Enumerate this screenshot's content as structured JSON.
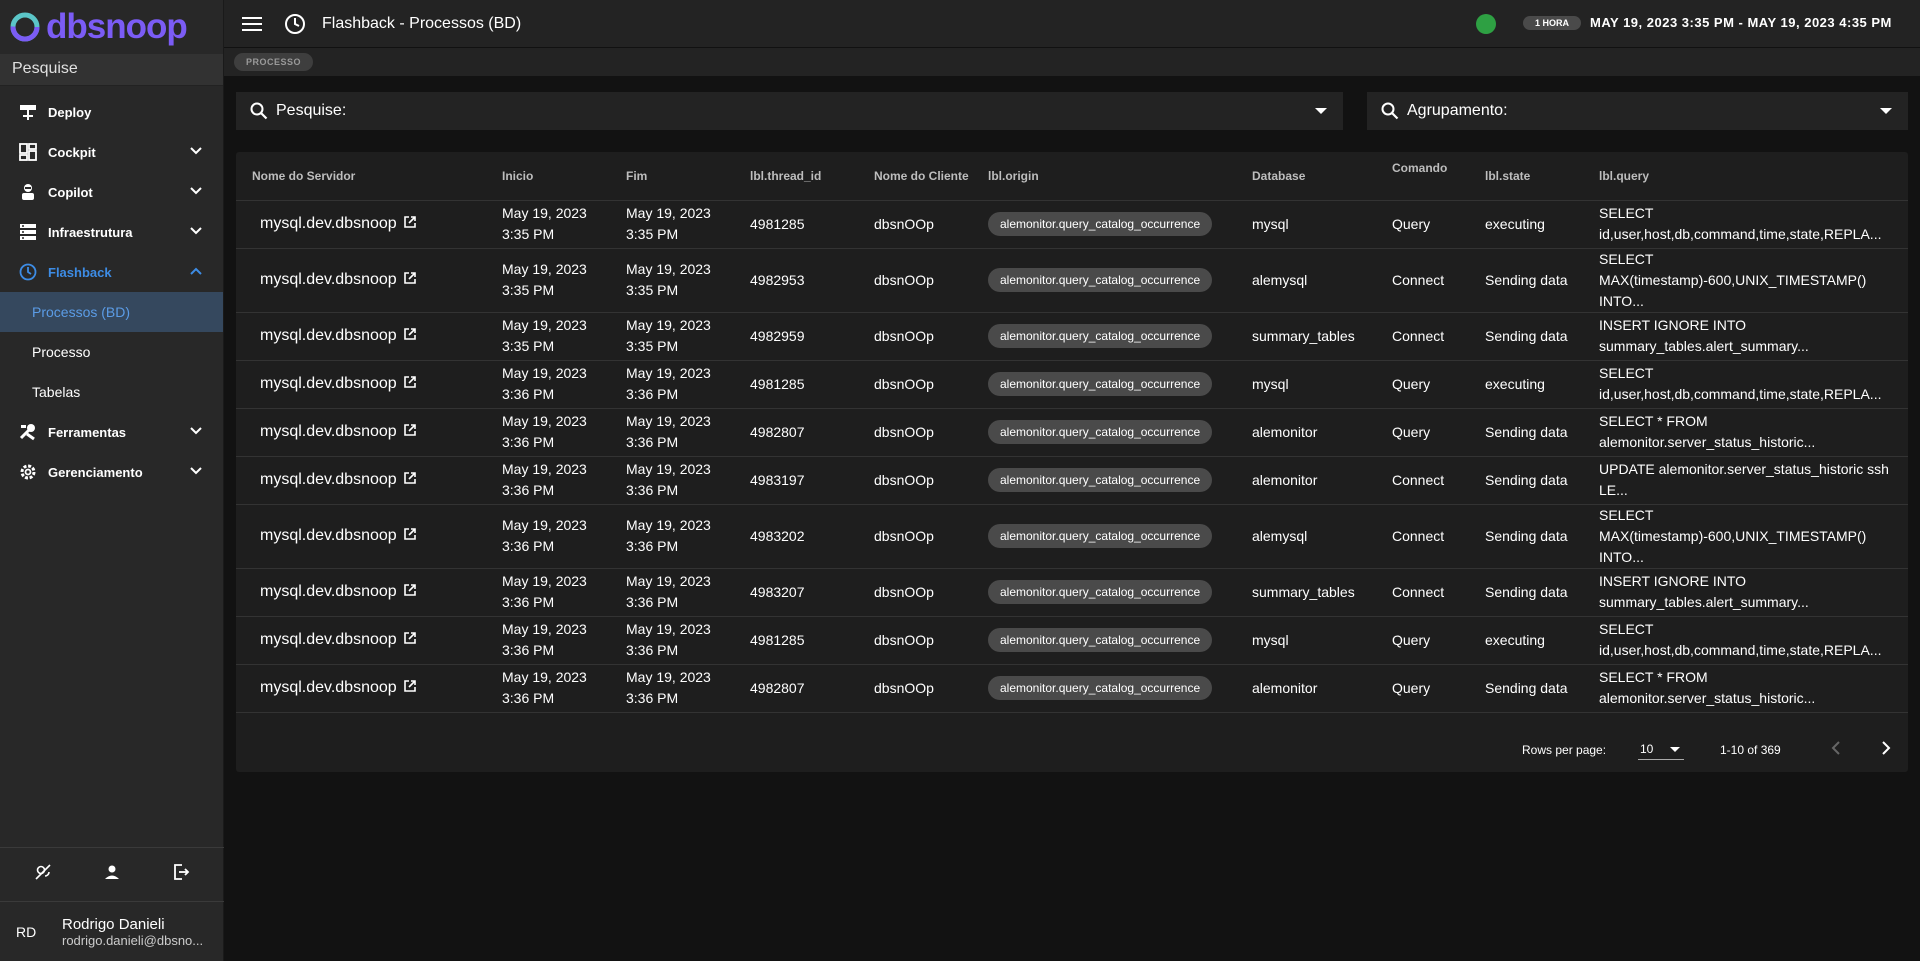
{
  "app": {
    "logo_text": "dbsnoop"
  },
  "sidebar": {
    "search_label": "Pesquise",
    "items": [
      {
        "label": "Deploy",
        "icon": "deploy-icon"
      },
      {
        "label": "Cockpit",
        "icon": "dashboard-icon"
      },
      {
        "label": "Copilot",
        "icon": "robot-icon"
      },
      {
        "label": "Infraestrutura",
        "icon": "server-icon"
      },
      {
        "label": "Flashback",
        "icon": "clock-icon"
      },
      {
        "label": "Ferramentas",
        "icon": "tools-icon"
      },
      {
        "label": "Gerenciamento",
        "icon": "gear-icon"
      }
    ],
    "sub_items": [
      "Processos (BD)",
      "Processo",
      "Tabelas"
    ],
    "user": {
      "initials": "RD",
      "name": "Rodrigo Danieli",
      "email": "rodrigo.danieli@dbsno..."
    }
  },
  "header": {
    "title": "Flashback - Processos (BD)",
    "range_chip": "1 HORA",
    "range_text": "MAY 19, 2023 3:35 PM - MAY 19, 2023 4:35 PM",
    "status_color": "#2ea043"
  },
  "breadcrumb": {
    "chip": "PROCESSO"
  },
  "filters": {
    "search_label": "Pesquise:",
    "group_label": "Agrupamento:"
  },
  "table": {
    "columns": [
      "Nome do Servidor",
      "Inicio",
      "Fim",
      "lbl.thread_id",
      "Nome do Cliente",
      "lbl.origin",
      "Database",
      "Comando",
      "lbl.state",
      "lbl.query"
    ],
    "rows": [
      {
        "server": "mysql.dev.dbsnoop",
        "start_date": "May 19, 2023",
        "start_time": "3:35 PM",
        "end_date": "May 19, 2023",
        "end_time": "3:35 PM",
        "thread": "4981285",
        "client": "dbsnOOp",
        "origin": "alemonitor.query_catalog_occurrence",
        "database": "mysql",
        "command": "Query",
        "state": "executing",
        "query": "SELECT id,user,host,db,command,time,state,REPLA..."
      },
      {
        "server": "mysql.dev.dbsnoop",
        "start_date": "May 19, 2023",
        "start_time": "3:35 PM",
        "end_date": "May 19, 2023",
        "end_time": "3:35 PM",
        "thread": "4982953",
        "client": "dbsnOOp",
        "origin": "alemonitor.query_catalog_occurrence",
        "database": "alemysql",
        "command": "Connect",
        "state": "Sending data",
        "query": "SELECT MAX(timestamp)-600,UNIX_TIMESTAMP() INTO..."
      },
      {
        "server": "mysql.dev.dbsnoop",
        "start_date": "May 19, 2023",
        "start_time": "3:35 PM",
        "end_date": "May 19, 2023",
        "end_time": "3:35 PM",
        "thread": "4982959",
        "client": "dbsnOOp",
        "origin": "alemonitor.query_catalog_occurrence",
        "database": "summary_tables",
        "command": "Connect",
        "state": "Sending data",
        "query": "INSERT IGNORE INTO summary_tables.alert_summary..."
      },
      {
        "server": "mysql.dev.dbsnoop",
        "start_date": "May 19, 2023",
        "start_time": "3:36 PM",
        "end_date": "May 19, 2023",
        "end_time": "3:36 PM",
        "thread": "4981285",
        "client": "dbsnOOp",
        "origin": "alemonitor.query_catalog_occurrence",
        "database": "mysql",
        "command": "Query",
        "state": "executing",
        "query": "SELECT id,user,host,db,command,time,state,REPLA..."
      },
      {
        "server": "mysql.dev.dbsnoop",
        "start_date": "May 19, 2023",
        "start_time": "3:36 PM",
        "end_date": "May 19, 2023",
        "end_time": "3:36 PM",
        "thread": "4982807",
        "client": "dbsnOOp",
        "origin": "alemonitor.query_catalog_occurrence",
        "database": "alemonitor",
        "command": "Query",
        "state": "Sending data",
        "query": "SELECT * FROM alemonitor.server_status_historic..."
      },
      {
        "server": "mysql.dev.dbsnoop",
        "start_date": "May 19, 2023",
        "start_time": "3:36 PM",
        "end_date": "May 19, 2023",
        "end_time": "3:36 PM",
        "thread": "4983197",
        "client": "dbsnOOp",
        "origin": "alemonitor.query_catalog_occurrence",
        "database": "alemonitor",
        "command": "Connect",
        "state": "Sending data",
        "query": "UPDATE alemonitor.server_status_historic ssh LE..."
      },
      {
        "server": "mysql.dev.dbsnoop",
        "start_date": "May 19, 2023",
        "start_time": "3:36 PM",
        "end_date": "May 19, 2023",
        "end_time": "3:36 PM",
        "thread": "4983202",
        "client": "dbsnOOp",
        "origin": "alemonitor.query_catalog_occurrence",
        "database": "alemysql",
        "command": "Connect",
        "state": "Sending data",
        "query": "SELECT MAX(timestamp)-600,UNIX_TIMESTAMP() INTO..."
      },
      {
        "server": "mysql.dev.dbsnoop",
        "start_date": "May 19, 2023",
        "start_time": "3:36 PM",
        "end_date": "May 19, 2023",
        "end_time": "3:36 PM",
        "thread": "4983207",
        "client": "dbsnOOp",
        "origin": "alemonitor.query_catalog_occurrence",
        "database": "summary_tables",
        "command": "Connect",
        "state": "Sending data",
        "query": "INSERT IGNORE INTO summary_tables.alert_summary..."
      },
      {
        "server": "mysql.dev.dbsnoop",
        "start_date": "May 19, 2023",
        "start_time": "3:36 PM",
        "end_date": "May 19, 2023",
        "end_time": "3:36 PM",
        "thread": "4981285",
        "client": "dbsnOOp",
        "origin": "alemonitor.query_catalog_occurrence",
        "database": "mysql",
        "command": "Query",
        "state": "executing",
        "query": "SELECT id,user,host,db,command,time,state,REPLA..."
      },
      {
        "server": "mysql.dev.dbsnoop",
        "start_date": "May 19, 2023",
        "start_time": "3:36 PM",
        "end_date": "May 19, 2023",
        "end_time": "3:36 PM",
        "thread": "4982807",
        "client": "dbsnOOp",
        "origin": "alemonitor.query_catalog_occurrence",
        "database": "alemonitor",
        "command": "Query",
        "state": "Sending data",
        "query": "SELECT * FROM alemonitor.server_status_historic..."
      }
    ]
  },
  "pagination": {
    "rows_per_page_label": "Rows per page:",
    "rows_per_page": "10",
    "range": "1-10 of 369"
  },
  "colors": {
    "accent": "#3d8ce5",
    "logo": "#7b5cf5",
    "status_ok": "#2ea043"
  }
}
